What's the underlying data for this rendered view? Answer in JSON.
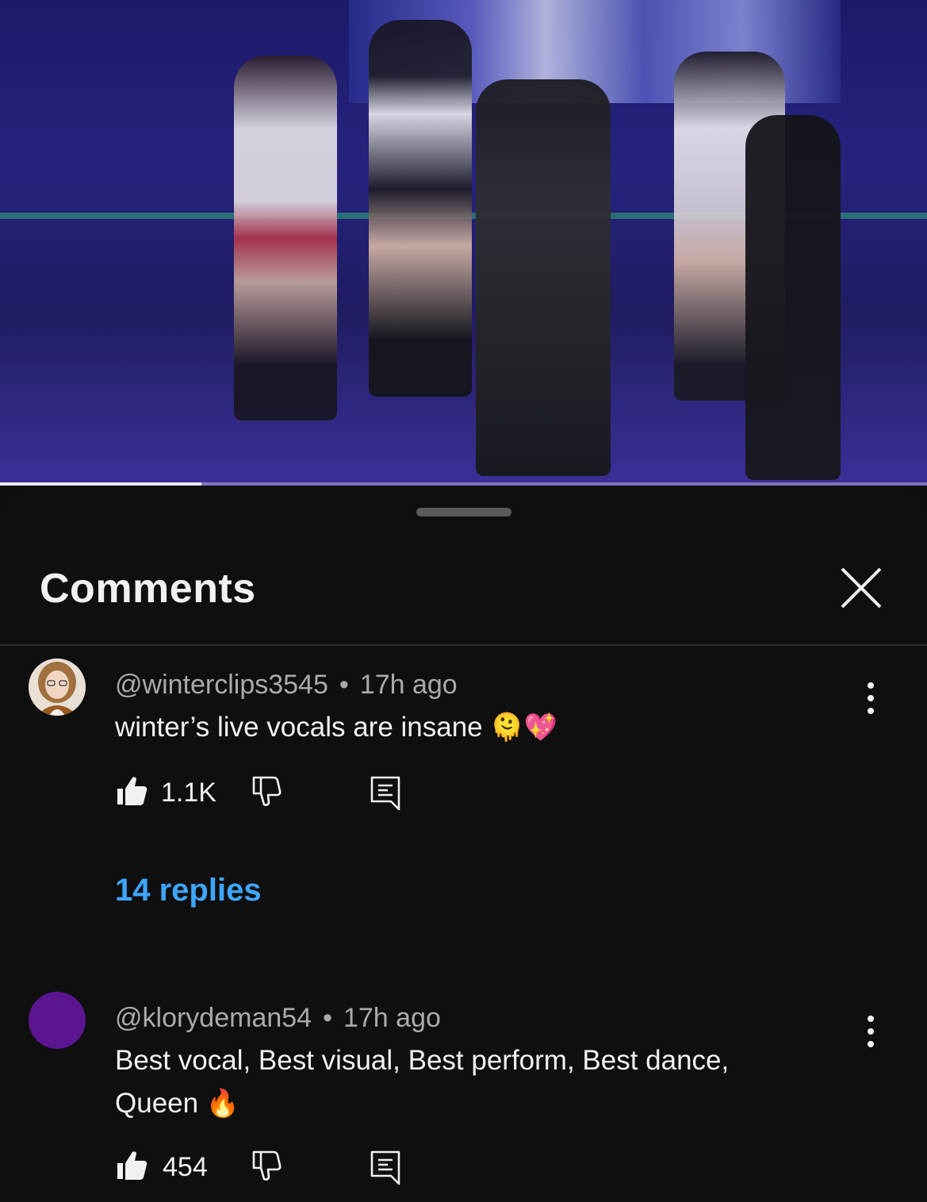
{
  "video": {
    "progress_fraction": 0.217,
    "play_state": "playing"
  },
  "comments_panel": {
    "title": "Comments",
    "close_icon": "close-icon"
  },
  "comments": [
    {
      "handle": "@winterclips3545",
      "separator": "•",
      "time": "17h ago",
      "text": "winter’s live vocals are insane",
      "emoji": "🫠💖",
      "likes": "1.1K",
      "replies_label": "14 replies",
      "avatar": "photo"
    },
    {
      "handle": "@klorydeman54",
      "separator": "•",
      "time": "17h ago",
      "text": "Best vocal, Best visual, Best perform, Best dance, Queen",
      "emoji": "🔥",
      "likes": "454",
      "avatar": "plain-purple"
    }
  ],
  "colors": {
    "background": "#0f0f0f",
    "link_blue": "#3ea6ff",
    "meta_gray": "#aaaaaa",
    "avatar_purple": "#5c1591"
  }
}
